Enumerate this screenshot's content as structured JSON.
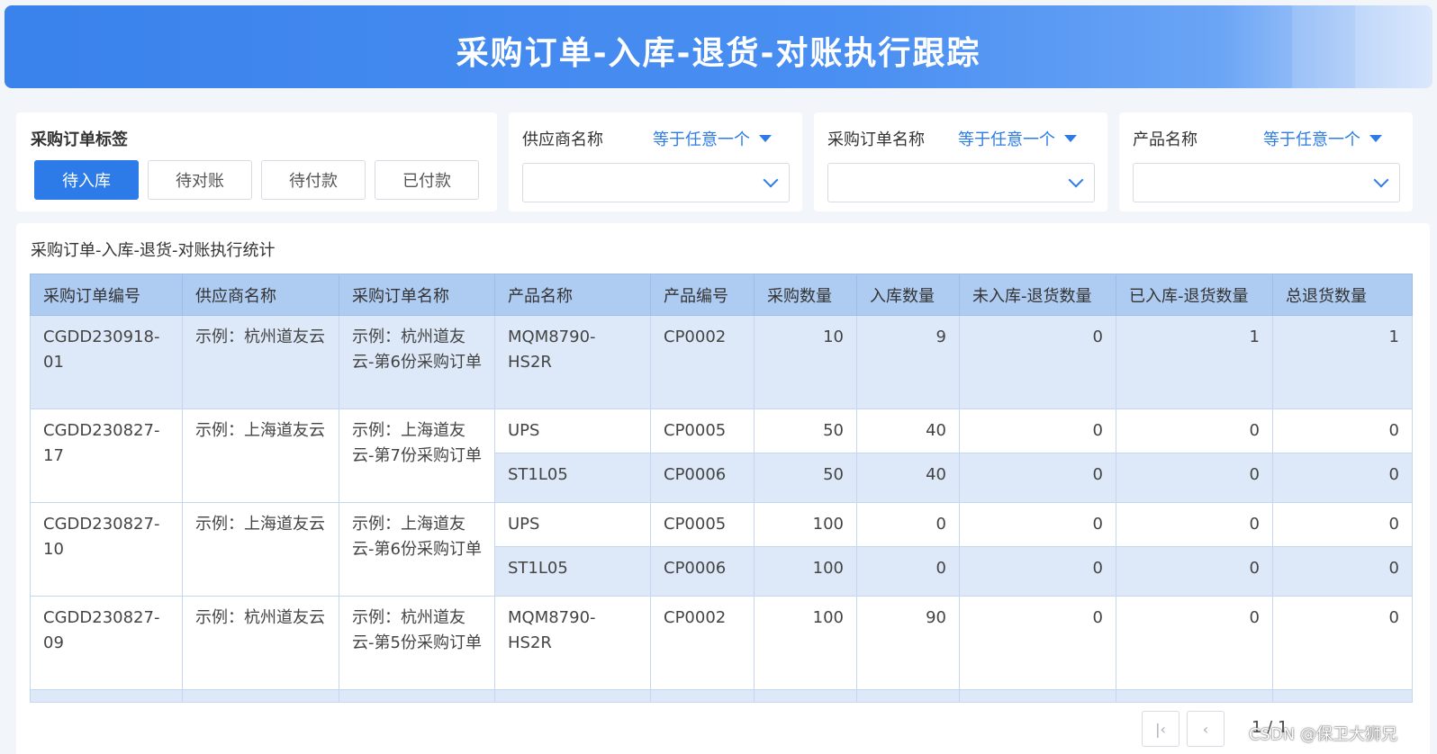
{
  "header": {
    "title": "采购订单-入库-退货-对账执行跟踪"
  },
  "tag_panel": {
    "label": "采购订单标签",
    "tags": [
      {
        "label": "待入库",
        "active": true
      },
      {
        "label": "待对账",
        "active": false
      },
      {
        "label": "待付款",
        "active": false
      },
      {
        "label": "已付款",
        "active": false
      }
    ]
  },
  "filters": [
    {
      "label": "供应商名称",
      "operator": "等于任意一个",
      "value": ""
    },
    {
      "label": "采购订单名称",
      "operator": "等于任意一个",
      "value": ""
    },
    {
      "label": "产品名称",
      "operator": "等于任意一个",
      "value": ""
    }
  ],
  "stats": {
    "title": "采购订单-入库-退货-对账执行统计",
    "columns": [
      "采购订单编号",
      "供应商名称",
      "采购订单名称",
      "产品名称",
      "产品编号",
      "采购数量",
      "入库数量",
      "未入库-退货数量",
      "已入库-退货数量",
      "总退货数量"
    ],
    "orders": [
      {
        "order_no": "CGDD230918-01",
        "supplier": "示例：杭州道友云",
        "order_name": "示例：杭州道友云-第6份采购订单",
        "items": [
          {
            "product": "MQM8790-HS2R",
            "code": "CP0002",
            "qty": "10",
            "in": "9",
            "ret_not_in": "0",
            "ret_in": "1",
            "ret_total": "1"
          }
        ]
      },
      {
        "order_no": "CGDD230827-17",
        "supplier": "示例：上海道友云",
        "order_name": "示例：上海道友云-第7份采购订单",
        "items": [
          {
            "product": "UPS",
            "code": "CP0005",
            "qty": "50",
            "in": "40",
            "ret_not_in": "0",
            "ret_in": "0",
            "ret_total": "0"
          },
          {
            "product": "ST1L05",
            "code": "CP0006",
            "qty": "50",
            "in": "40",
            "ret_not_in": "0",
            "ret_in": "0",
            "ret_total": "0"
          }
        ]
      },
      {
        "order_no": "CGDD230827-10",
        "supplier": "示例：上海道友云",
        "order_name": "示例：上海道友云-第6份采购订单",
        "items": [
          {
            "product": "UPS",
            "code": "CP0005",
            "qty": "100",
            "in": "0",
            "ret_not_in": "0",
            "ret_in": "0",
            "ret_total": "0"
          },
          {
            "product": "ST1L05",
            "code": "CP0006",
            "qty": "100",
            "in": "0",
            "ret_not_in": "0",
            "ret_in": "0",
            "ret_total": "0"
          }
        ]
      },
      {
        "order_no": "CGDD230827-09",
        "supplier": "示例：杭州道友云",
        "order_name": "示例：杭州道友云-第5份采购订单",
        "items": [
          {
            "product": "MQM8790-HS2R",
            "code": "CP0002",
            "qty": "100",
            "in": "90",
            "ret_not_in": "0",
            "ret_in": "0",
            "ret_total": "0"
          }
        ]
      }
    ]
  },
  "pagination": {
    "first_icon": "first-page-icon",
    "prev_icon": "prev-page-icon",
    "page_text": "1 / 1"
  },
  "watermark": "CSDN @保卫大狮兄",
  "colors": {
    "accent": "#2d7be8",
    "header_row": "#aecbf2",
    "shade_row": "#dde8f8"
  }
}
